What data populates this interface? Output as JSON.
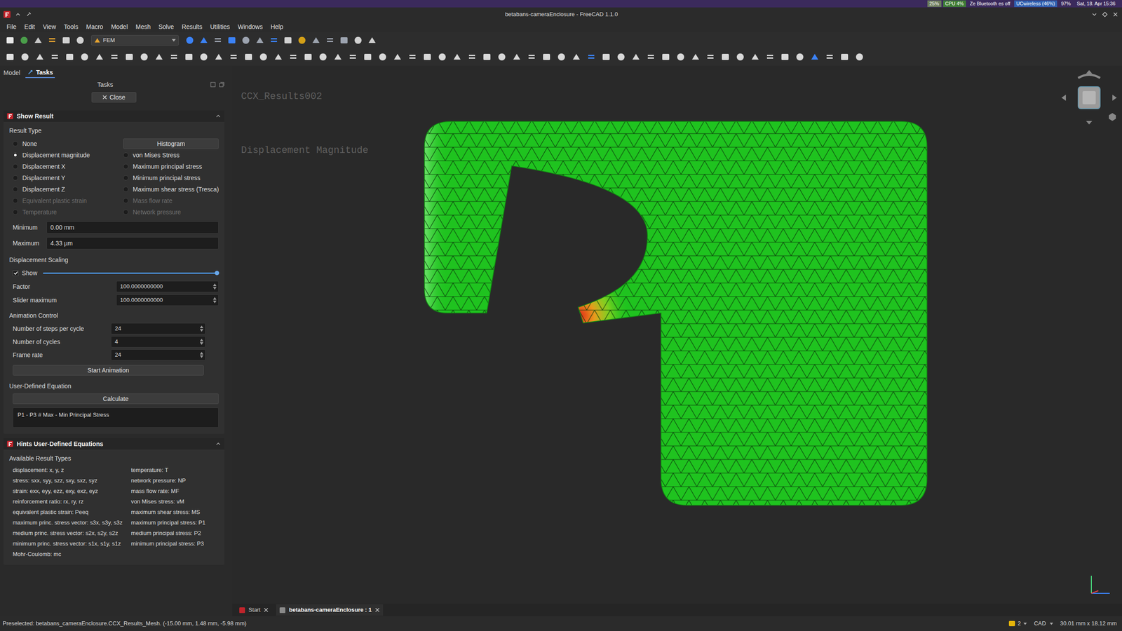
{
  "system_bar": [
    {
      "text": "25%",
      "color": "#6b7b5c"
    },
    {
      "text": "CPU 4%",
      "color": "#3f7d35"
    },
    {
      "text": "Ze Bluetooth es off",
      "color": "#3b2a5c"
    },
    {
      "text": "UCwireless (46%)",
      "color": "#2f5fb0"
    },
    {
      "text": "97%",
      "color": "#3b2a5c"
    },
    {
      "text": "Sat, 18. Apr 15:36",
      "color": "#3b2a5c"
    }
  ],
  "window": {
    "title": "betabans-cameraEnclosure - FreeCAD 1.1.0"
  },
  "menu": [
    "File",
    "Edit",
    "View",
    "Tools",
    "Macro",
    "Model",
    "Mesh",
    "Solve",
    "Results",
    "Utilities",
    "Windows",
    "Help"
  ],
  "workbench": "FEM",
  "panel_tabs": [
    {
      "label": "Model",
      "selected": false
    },
    {
      "label": "Tasks",
      "selected": true
    }
  ],
  "tasks": {
    "title": "Tasks",
    "close": "Close"
  },
  "show_result": {
    "title": "Show Result",
    "result_type_label": "Result Type",
    "histogram": "Histogram",
    "left_options": [
      {
        "label": "None",
        "selected": false,
        "disabled": false
      },
      {
        "label": "Displacement magnitude",
        "selected": true,
        "disabled": false
      },
      {
        "label": "Displacement X",
        "selected": false,
        "disabled": false
      },
      {
        "label": "Displacement Y",
        "selected": false,
        "disabled": false
      },
      {
        "label": "Displacement Z",
        "selected": false,
        "disabled": false
      },
      {
        "label": "Equivalent plastic strain",
        "selected": false,
        "disabled": true
      },
      {
        "label": "Temperature",
        "selected": false,
        "disabled": true
      }
    ],
    "right_options": [
      {
        "label": "von Mises Stress",
        "selected": false,
        "disabled": false
      },
      {
        "label": "Maximum principal stress",
        "selected": false,
        "disabled": false
      },
      {
        "label": "Minimum principal stress",
        "selected": false,
        "disabled": false
      },
      {
        "label": "Maximum shear stress (Tresca)",
        "selected": false,
        "disabled": false
      },
      {
        "label": "Mass flow rate",
        "selected": false,
        "disabled": true
      },
      {
        "label": "Network pressure",
        "selected": false,
        "disabled": true
      }
    ],
    "minimum": {
      "label": "Minimum",
      "value": "0.00 mm"
    },
    "maximum": {
      "label": "Maximum",
      "value": "4.33 µm"
    },
    "scaling": {
      "title": "Displacement Scaling",
      "show": {
        "label": "Show",
        "checked": true,
        "level": 1
      },
      "factor": {
        "label": "Factor",
        "value": "100.0000000000"
      },
      "slider_maximum": {
        "label": "Slider maximum",
        "value": "100.0000000000"
      }
    },
    "animation": {
      "title": "Animation Control",
      "fields": [
        {
          "label": "Number of steps per cycle",
          "value": "24"
        },
        {
          "label": "Number of cycles",
          "value": "4"
        },
        {
          "label": "Frame rate",
          "value": "24"
        }
      ],
      "button": "Start Animation"
    },
    "equation": {
      "title": "User-Defined Equation",
      "button": "Calculate",
      "text": "P1 - P3 # Max - Min Principal Stress"
    }
  },
  "hints": {
    "title": "Hints User-Defined Equations",
    "subtitle": "Available Result Types",
    "left": [
      "displacement: x, y, z",
      "stress: sxx, syy, szz, sxy, sxz, syz",
      "strain: exx, eyy, ezz, exy, exz, eyz",
      "reinforcement ratio: rx, ry, rz",
      "equivalent plastic strain: Peeq",
      "maximum princ. stress vector: s3x, s3y, s3z",
      "medium princ. stress vector: s2x, s2y, s2z",
      "minimum princ. stress vector: s1x, s1y, s1z",
      "Mohr-Coulomb: mc"
    ],
    "right": [
      "temperature: T",
      "network pressure: NP",
      "mass flow rate: MF",
      "von Mises stress: vM",
      "maximum shear stress: MS",
      "maximum principal stress: P1",
      "medium principal stress: P2",
      "minimum principal stress: P3"
    ]
  },
  "view": {
    "result_name": "CCX_Results002",
    "result_type": "Displacement Magnitude"
  },
  "doc_tabs": [
    {
      "label": "Start",
      "selected": false
    },
    {
      "label": "betabans-cameraEnclosure : 1",
      "selected": true
    }
  ],
  "status_bar": {
    "text": "Preselected: betabans_cameraEnclosure.CCX_Results_Mesh. (-15.00 mm, 1.48 mm, -5.98 mm)",
    "count": "2",
    "nav": "CAD",
    "dimensions": "30.01 mm x 18.12 mm"
  }
}
